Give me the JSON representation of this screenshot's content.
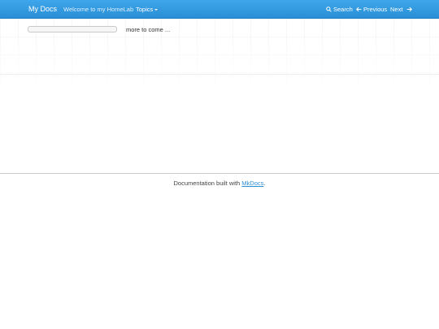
{
  "navbar": {
    "brand": "My Docs",
    "welcome_link": "Welcome to my HomeLab",
    "topics_label": "Topics",
    "search_label": "Search",
    "previous_label": "Previous",
    "next_label": "Next"
  },
  "main": {
    "text": "more to come ..."
  },
  "footer": {
    "prefix": "Documentation built with ",
    "link": "MkDocs",
    "suffix": "."
  },
  "colors": {
    "navbar": "#2a8fd6",
    "link": "#2a8fd6"
  },
  "icons": {
    "search": "search-icon",
    "previous": "arrow-left-icon",
    "next": "arrow-right-icon",
    "topics": "caret-down-icon"
  }
}
